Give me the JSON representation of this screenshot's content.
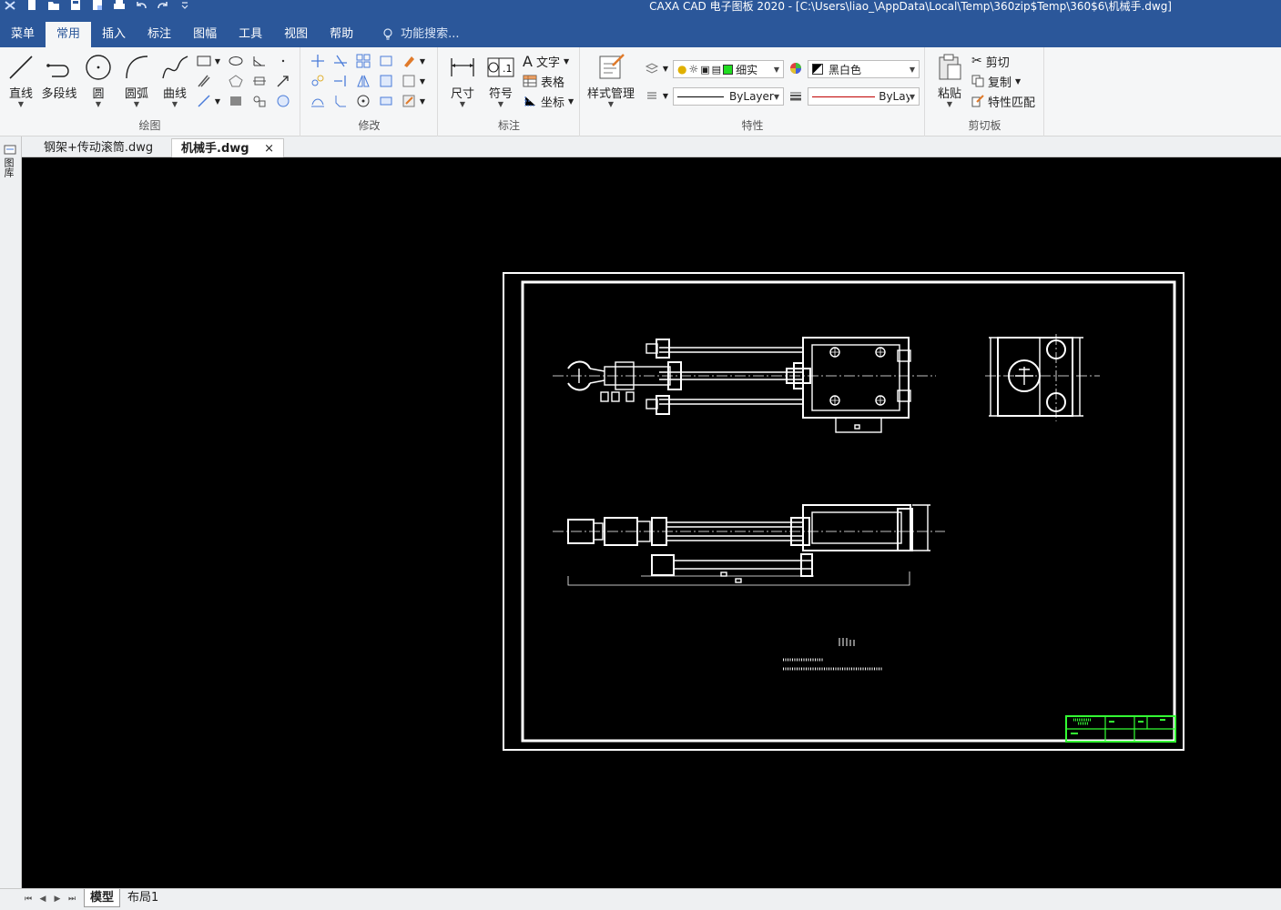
{
  "window": {
    "title": "CAXA CAD 电子图板 2020 - [C:\\Users\\liao_\\AppData\\Local\\Temp\\360zip$Temp\\360$6\\机械手.dwg]"
  },
  "ribbon_tabs": [
    {
      "label": "菜单",
      "active": false
    },
    {
      "label": "常用",
      "active": true
    },
    {
      "label": "插入",
      "active": false
    },
    {
      "label": "标注",
      "active": false
    },
    {
      "label": "图幅",
      "active": false
    },
    {
      "label": "工具",
      "active": false
    },
    {
      "label": "视图",
      "active": false
    },
    {
      "label": "帮助",
      "active": false
    }
  ],
  "search": {
    "placeholder": "功能搜索..."
  },
  "groups": {
    "draw": {
      "label": "绘图",
      "buttons": [
        "直线",
        "多段线",
        "圆",
        "圆弧",
        "曲线"
      ]
    },
    "modify": {
      "label": "修改"
    },
    "annotate": {
      "label": "标注",
      "buttons": [
        "尺寸",
        "符号"
      ],
      "small": [
        "文字",
        "表格",
        "坐标"
      ]
    },
    "properties": {
      "label": "特性",
      "style_button": "样式管理",
      "layer_value": "细实",
      "color_value": "黑白色",
      "linetype_value": "ByLayer",
      "lineweight_value": "ByLayer"
    },
    "clipboard": {
      "label": "剪切板",
      "paste": "粘贴",
      "small": [
        "剪切",
        "复制",
        "特性匹配"
      ]
    }
  },
  "doc_tabs": [
    {
      "label": "钢架+传动滚筒.dwg",
      "active": false
    },
    {
      "label": "机械手.dwg",
      "active": true
    }
  ],
  "doc_tab_close": "×",
  "side_panel": {
    "label": "图库"
  },
  "layout_tabs": [
    {
      "label": "模型",
      "active": true
    },
    {
      "label": "布局1",
      "active": false
    }
  ],
  "nav_buttons": [
    "⏮",
    "◀",
    "▶",
    "⏭"
  ],
  "colors": {
    "titlebar": "#2b579a",
    "canvas": "#000000",
    "drawing_lines": "#ffffff",
    "title_block": "#33ff33",
    "layer_swatch": "#22dd22"
  }
}
